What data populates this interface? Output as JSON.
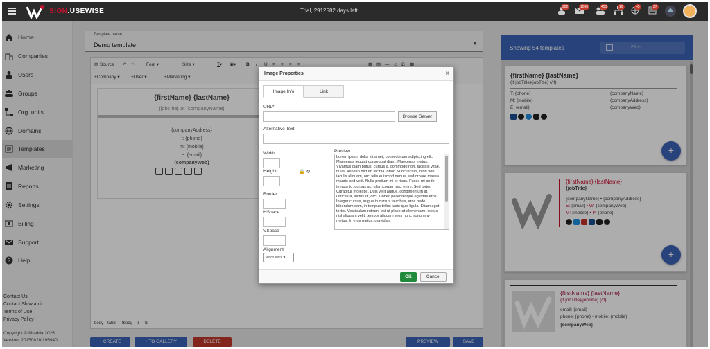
{
  "topbar": {
    "brand_prefix": "SIGN",
    "brand_suffix": ".USEWISE",
    "trial": "Trial, 2912582 days left",
    "badges": [
      "922",
      "1068",
      "450",
      "16",
      "45",
      "27"
    ]
  },
  "sidebar": {
    "items": [
      {
        "label": "Home",
        "icon": "home-icon"
      },
      {
        "label": "Companies",
        "icon": "companies-icon"
      },
      {
        "label": "Users",
        "icon": "users-icon"
      },
      {
        "label": "Groups",
        "icon": "groups-icon"
      },
      {
        "label": "Org. units",
        "icon": "org-units-icon"
      },
      {
        "label": "Domains",
        "icon": "globe-icon"
      },
      {
        "label": "Templates",
        "icon": "templates-icon"
      },
      {
        "label": "Marketing",
        "icon": "megaphone-icon"
      },
      {
        "label": "Reports",
        "icon": "reports-icon"
      },
      {
        "label": "Settings",
        "icon": "gear-icon"
      },
      {
        "label": "Billing",
        "icon": "billing-icon"
      },
      {
        "label": "Support",
        "icon": "mail-icon"
      },
      {
        "label": "Help",
        "icon": "help-icon"
      }
    ],
    "links": [
      "Contact Us",
      "Contact Shivaami",
      "Terms of Use",
      "Privacy Policy"
    ],
    "copyright": "Copyright © Miadria 2025.",
    "version": "Version: 20250828f195940"
  },
  "main": {
    "template_label": "Template name",
    "template_name": "Demo template",
    "toolbar": {
      "source": "Source",
      "font": "Font",
      "size": "Size",
      "company": "+Company",
      "user": "+User",
      "marketing": "+Marketing"
    },
    "preview": {
      "name": "{firstName} {lastName}",
      "subtitle": "{jobTitle} at {companyName}",
      "address": "{companyAddress}",
      "phone": "t: {phone}",
      "mobile": "m: {mobile}",
      "email": "e: {email}",
      "web": "{companyWeb}"
    },
    "statusbar": [
      "body",
      "table",
      "tbody",
      "tr",
      "td"
    ],
    "actions": {
      "create": "+ CREATE",
      "to_gallery": "+ TO GALLERY",
      "delete": "DELETE",
      "preview": "PREVIEW",
      "save": "SAVE"
    }
  },
  "modal": {
    "title": "Image Properties",
    "tabs": [
      "Image Info",
      "Link"
    ],
    "url_label": "URL*",
    "browse": "Browse Server",
    "alt_label": "Alternative Text",
    "width": "Width",
    "height": "Height",
    "border": "Border",
    "hspace": "HSpace",
    "vspace": "VSpace",
    "alignment": "Alignment",
    "align_value": "<not set>",
    "preview_label": "Preview",
    "preview_text": "Lorem ipsum dolor sit amet, consectetuer adipiscing elit. Maecenas feugiat consequat diam. Maecenas metus. Vivamus diam purus, cursus a, commodo non, facilisis vitae, nulla. Aenean dictum lacinia tortor. Nunc iaculis, nibh non iaculis aliquam, orci felis euismod neque, sed ornare massa mauris sed velit. Nulla pretium mi et risus. Fusce mi pede, tempor id, cursus ac, ullamcorper nec, enim. Sed tortor. Curabitur molestie. Duis velit augue, condimentum at, ultrices a, luctus ut, orci. Donec pellentesque egestas eros. Integer cursus, augue in cursus faucibus, eros pede bibendum sem, in tempus tellus justo quis ligula. Etiam eget tortor. Vestibulum rutrum, est ut placerat elementum, lectus nisl aliquam velit, tempor aliquam eros nunc nonummy metus. In eros metus, gravida a",
    "ok": "OK",
    "cancel": "Cancel"
  },
  "templates": {
    "count_text": "Showing 54 templates",
    "filter_placeholder": "Filter...",
    "card1": {
      "name": "{firstName} {lastName}",
      "sub": "{if jobTitle}{jobTitle} {/if}",
      "t": "T: {phone}",
      "m": "M: {mobile}",
      "e": "E: {email}",
      "company": "{companyName}",
      "address": "{companyAddress}",
      "web": "{companyWeb}"
    },
    "card2": {
      "name": "{firstName} {lastName}",
      "job": "{jobTitle}",
      "company_line": "{companyName} • {companyAddress}",
      "e_label": "E:",
      "e_val": "{email}",
      "w_label": "• W:",
      "w_val": "{companyWeb}",
      "m_label": "M:",
      "m_val": "{mobile}",
      "p_label": "• P:",
      "p_val": "{phone}"
    },
    "card3": {
      "name": "{firstName} {lastName}",
      "sub": "{if jobTitle}{jobTitle} {/if}",
      "email": "email: {email}",
      "phone": "phone: {phone} • mobile: {mobile}",
      "web": "{companyWeb}"
    }
  },
  "colors": {
    "accent": "#3b63b6",
    "brand_red": "#c8102e",
    "ok_green": "#1e8a3a"
  }
}
